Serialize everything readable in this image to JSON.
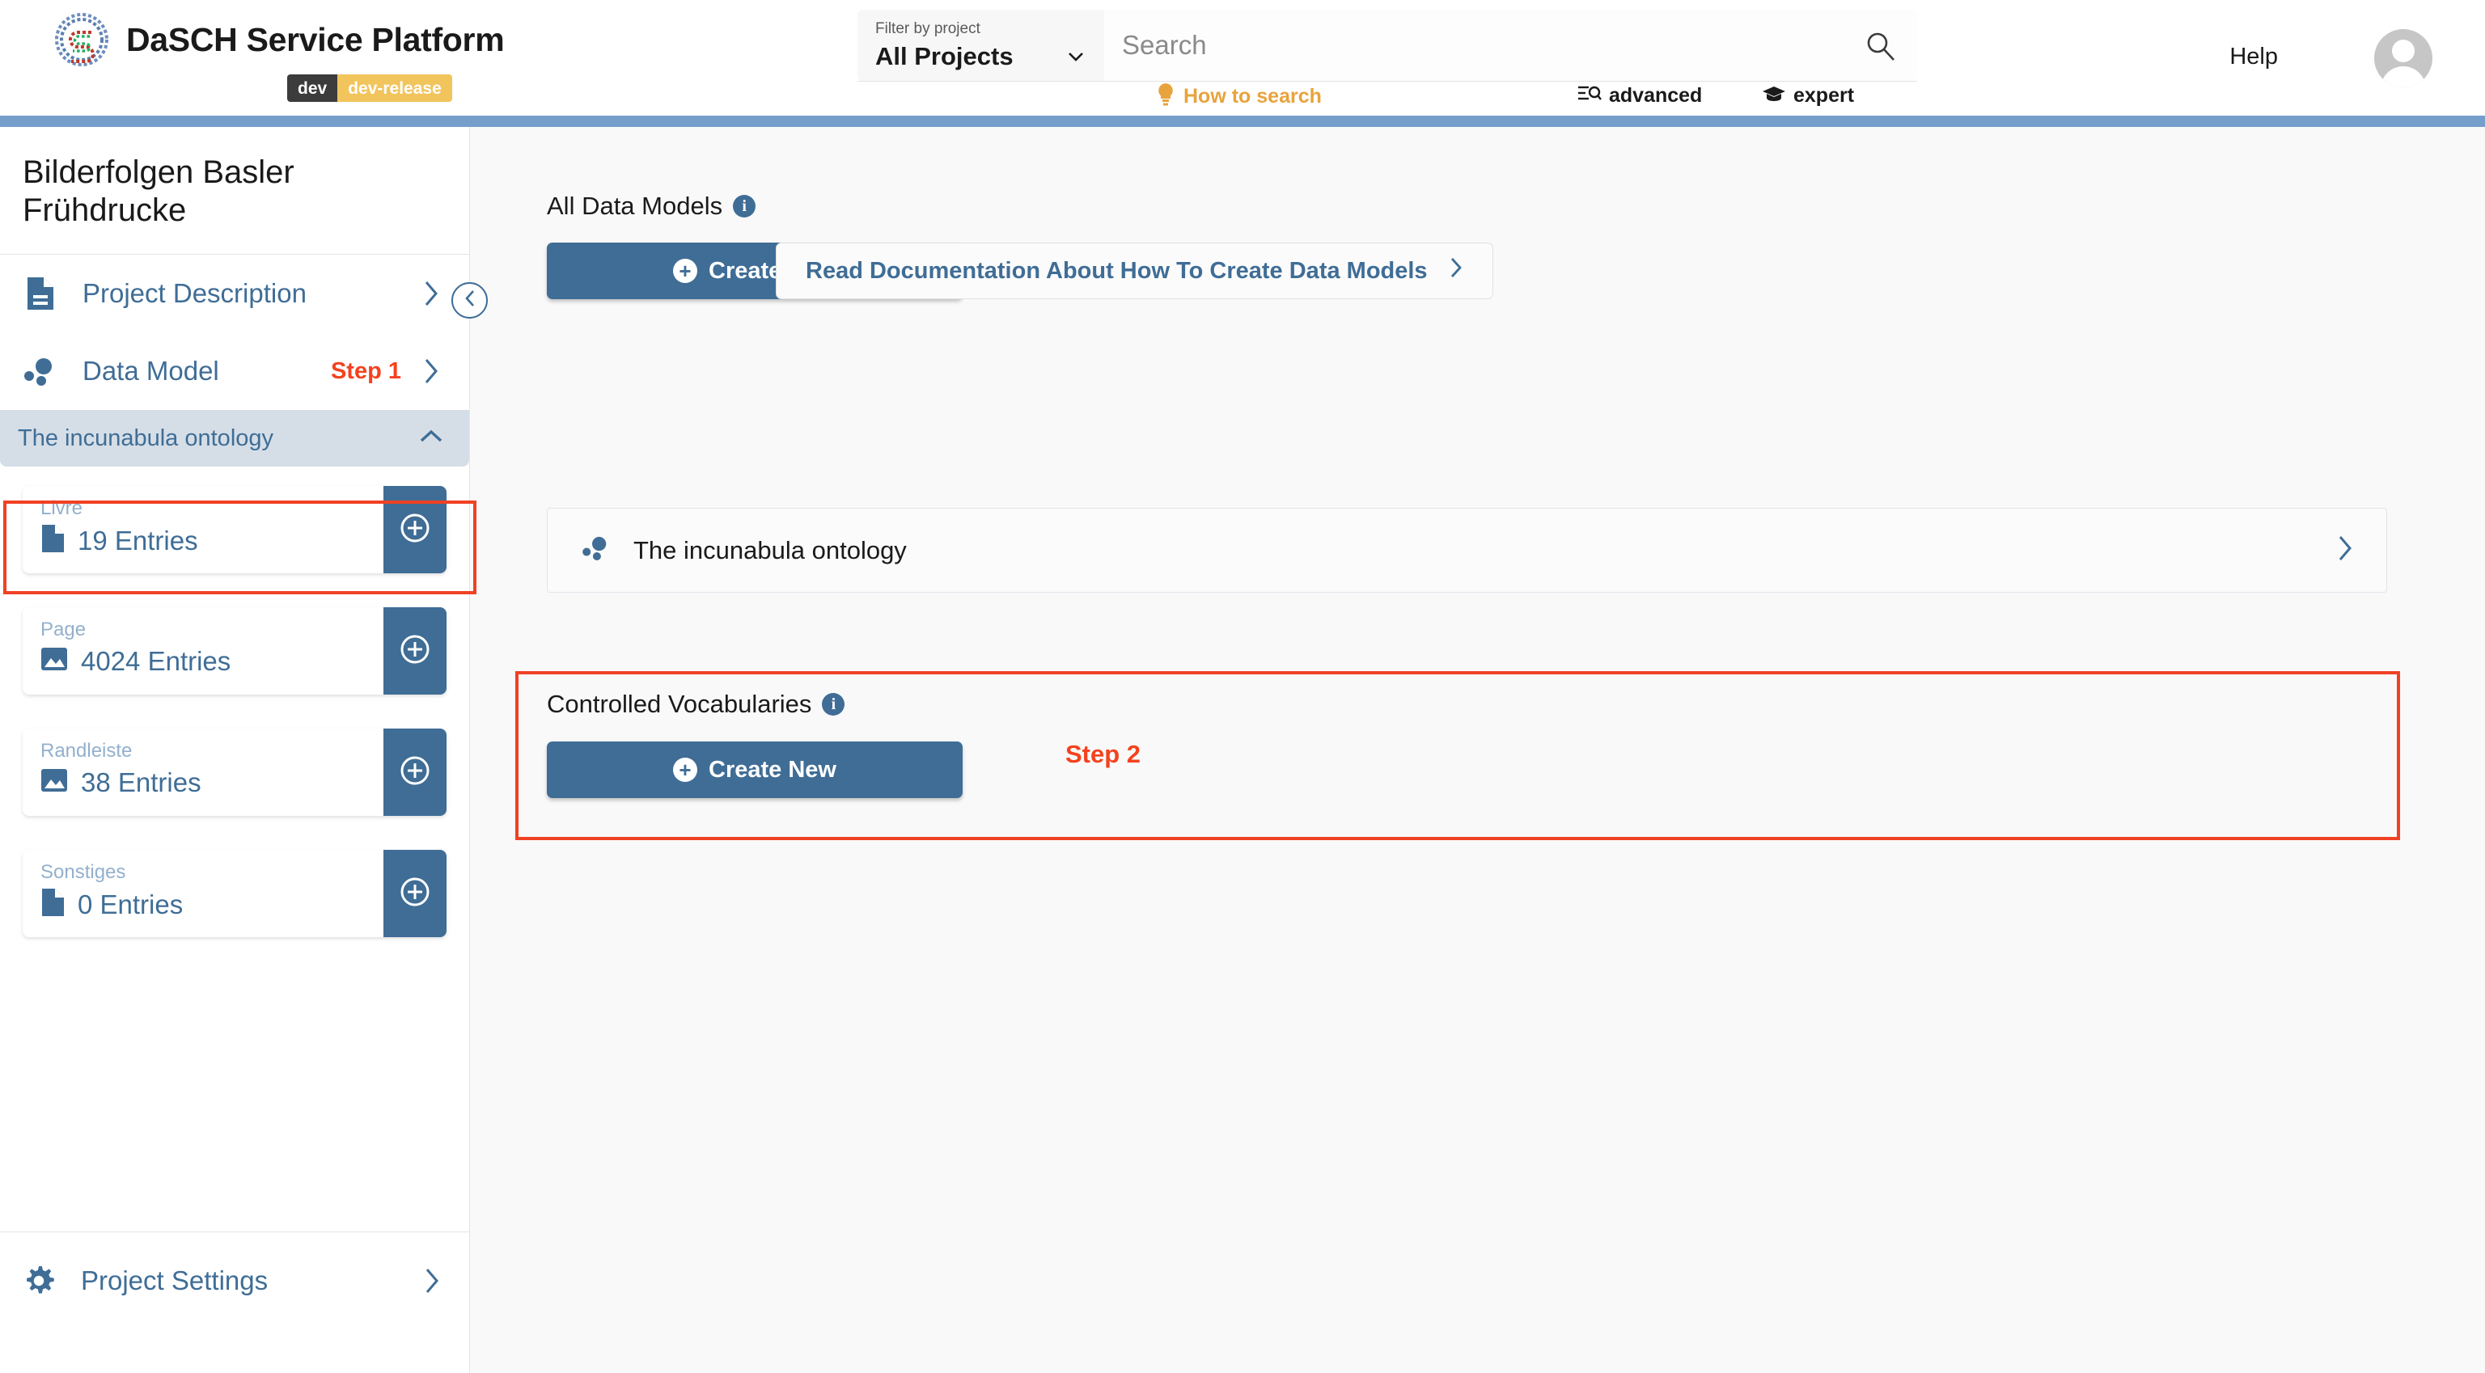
{
  "header": {
    "logo_icon": "dasch-spiral-logo",
    "brand_title": "DaSCH Service Platform",
    "badge_env": "dev",
    "badge_release": "dev-release",
    "project_filter": {
      "label": "Filter by project",
      "value": "All Projects",
      "caret_icon": "chevron-down-icon"
    },
    "search": {
      "placeholder": "Search",
      "value": "",
      "icon": "search-icon"
    },
    "links": {
      "how_to_search": "How to search",
      "how_to_search_icon": "lightbulb-icon",
      "advanced": "advanced",
      "advanced_icon": "advanced-search-icon",
      "expert": "expert",
      "expert_icon": "graduation-cap-icon"
    },
    "help": "Help",
    "avatar_icon": "user-avatar-icon"
  },
  "sidebar": {
    "project_title": "Bilderfolgen Basler Frühdrucke",
    "collapse_icon": "chevron-left-icon",
    "nav": [
      {
        "label": "Project Description",
        "icon": "document-icon",
        "chevron": "chevron-right-icon",
        "step": ""
      },
      {
        "label": "Data Model",
        "icon": "data-model-dots-icon",
        "chevron": "chevron-right-icon",
        "step": "Step 1"
      }
    ],
    "ontology": {
      "label": "The incunabula ontology",
      "collapse_icon": "chevron-up-icon"
    },
    "entries": [
      {
        "label": "Livre",
        "count": "19 Entries",
        "icon": "document-icon",
        "add_icon": "plus-circle-icon"
      },
      {
        "label": "Page",
        "count": "4024 Entries",
        "icon": "image-icon",
        "add_icon": "plus-circle-icon"
      },
      {
        "label": "Randleiste",
        "count": "38 Entries",
        "icon": "image-icon",
        "add_icon": "plus-circle-icon"
      },
      {
        "label": "Sonstiges",
        "count": "0 Entries",
        "icon": "document-icon",
        "add_icon": "plus-circle-icon"
      }
    ],
    "settings": {
      "label": "Project Settings",
      "icon": "gear-icon",
      "chevron": "chevron-right-icon"
    }
  },
  "main": {
    "data_models": {
      "heading": "All Data Models",
      "info_icon": "info-icon",
      "create_new": "Create New",
      "create_new_icon": "plus-circle-icon",
      "read_docs": "Read Documentation About How To Create Data Models",
      "read_docs_chevron": "chevron-right-icon"
    },
    "ontology_row": {
      "label": "The incunabula ontology",
      "icon": "data-model-dots-icon",
      "chevron": "chevron-right-icon"
    },
    "vocabularies": {
      "heading": "Controlled Vocabularies",
      "info_icon": "info-icon",
      "create_new": "Create New",
      "create_new_icon": "plus-circle-icon",
      "step": "Step 2"
    }
  },
  "colors": {
    "accent_blue": "#3f6d96",
    "bar_blue": "#769ecb",
    "annotation_red": "#f04124",
    "badge_yellow": "#f2c45c",
    "link_orange": "#e8a33d",
    "page_bg": "#f9f9f9"
  }
}
